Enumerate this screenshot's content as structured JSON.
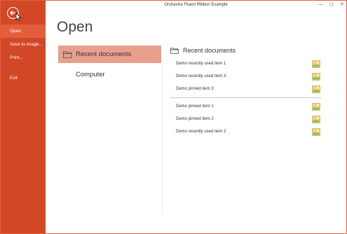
{
  "window": {
    "title": "Orchestra Fluent Ribbon Example"
  },
  "window_controls": {
    "minimize": "—",
    "maximize": "◻",
    "close": "✕"
  },
  "backstage": {
    "items": [
      {
        "label": "Open"
      },
      {
        "label": "Save to image..."
      },
      {
        "label": "Print..."
      },
      {
        "label": "Exit"
      }
    ]
  },
  "page": {
    "heading": "Open"
  },
  "places": [
    {
      "label": "Recent documents"
    },
    {
      "label": "Computer"
    }
  ],
  "recent": {
    "header": "Recent documents",
    "recent_items": [
      {
        "label": "Demo recently used item 1"
      },
      {
        "label": "Demo recently used item 3"
      },
      {
        "label": "Demo pinned item 3"
      }
    ],
    "pinned_items": [
      {
        "label": "Demo pinned item 1"
      },
      {
        "label": "Demo pinned item 2"
      },
      {
        "label": "Demo recently used item 2"
      }
    ]
  },
  "colors": {
    "accent": "#d24726",
    "accent_light": "#e25f3e",
    "selection": "#e8a08c"
  }
}
